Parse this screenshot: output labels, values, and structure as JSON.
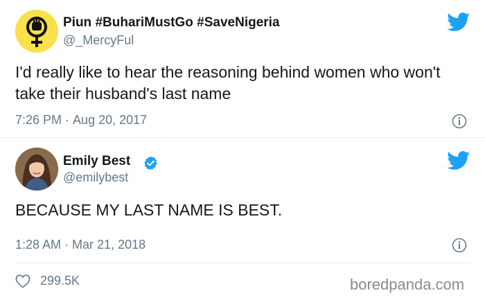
{
  "tweets": [
    {
      "display_name": "Piun #BuhariMustGo #SaveNigeria",
      "handle": "@_MercyFul",
      "text": "I'd really like to hear the reasoning behind women who won't take their husband's last name",
      "time": "7:26 PM",
      "date": "Aug 20, 2017",
      "separator": "·",
      "avatar_icon": "feminist-fist-symbol-icon"
    },
    {
      "display_name": "Emily Best",
      "handle": "@emilybest",
      "verified": true,
      "text": "BECAUSE MY LAST NAME IS BEST.",
      "time": "1:28 AM",
      "date": "Mar 21, 2018",
      "separator": "·",
      "likes": "299.5K",
      "avatar_icon": "profile-photo-woman"
    }
  ],
  "watermark": "boredpanda.com",
  "colors": {
    "twitter_blue": "#1da1f2",
    "text": "#14171a",
    "muted": "#657786",
    "divider": "#e6ecf0",
    "avatar1_bg": "#f8e14a"
  }
}
